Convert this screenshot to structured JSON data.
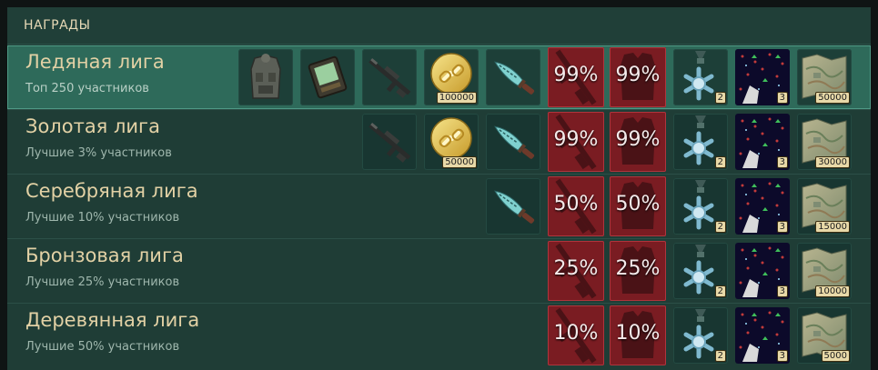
{
  "header": {
    "title": "НАГРАДЫ"
  },
  "colors": {
    "panel": "#1f3d36",
    "active_row": "#2e6a5a",
    "league_text": "#e2d1a5",
    "discount_bg": "#7a1c22"
  },
  "leagues": [
    {
      "name": "Ледяная лига",
      "subtitle": "Топ 250 участников",
      "active": true,
      "rewards": {
        "armor_vest": "armor-vest-icon",
        "device": "device-icon",
        "rifle": "rifle-icon",
        "coins_amount": "100000",
        "knife": "knife-icon",
        "weapon_discount": "99%",
        "armor_discount": "99%",
        "medal_count": "2",
        "cards_count": "3",
        "map_amount": "50000"
      }
    },
    {
      "name": "Золотая лига",
      "subtitle": "Лучшие 3% участников",
      "active": false,
      "rewards": {
        "rifle": "rifle-icon",
        "coins_amount": "50000",
        "knife": "knife-icon",
        "weapon_discount": "99%",
        "armor_discount": "99%",
        "medal_count": "2",
        "cards_count": "3",
        "map_amount": "30000"
      }
    },
    {
      "name": "Серебряная лига",
      "subtitle": "Лучшие 10% участников",
      "active": false,
      "rewards": {
        "knife": "knife-icon",
        "weapon_discount": "50%",
        "armor_discount": "50%",
        "medal_count": "2",
        "cards_count": "3",
        "map_amount": "15000"
      }
    },
    {
      "name": "Бронзовая лига",
      "subtitle": "Лучшие 25% участников",
      "active": false,
      "rewards": {
        "weapon_discount": "25%",
        "armor_discount": "25%",
        "medal_count": "2",
        "cards_count": "3",
        "map_amount": "10000"
      }
    },
    {
      "name": "Деревянная лига",
      "subtitle": "Лучшие 50% участников",
      "active": false,
      "rewards": {
        "weapon_discount": "10%",
        "armor_discount": "10%",
        "medal_count": "2",
        "cards_count": "3",
        "map_amount": "5000"
      }
    }
  ]
}
